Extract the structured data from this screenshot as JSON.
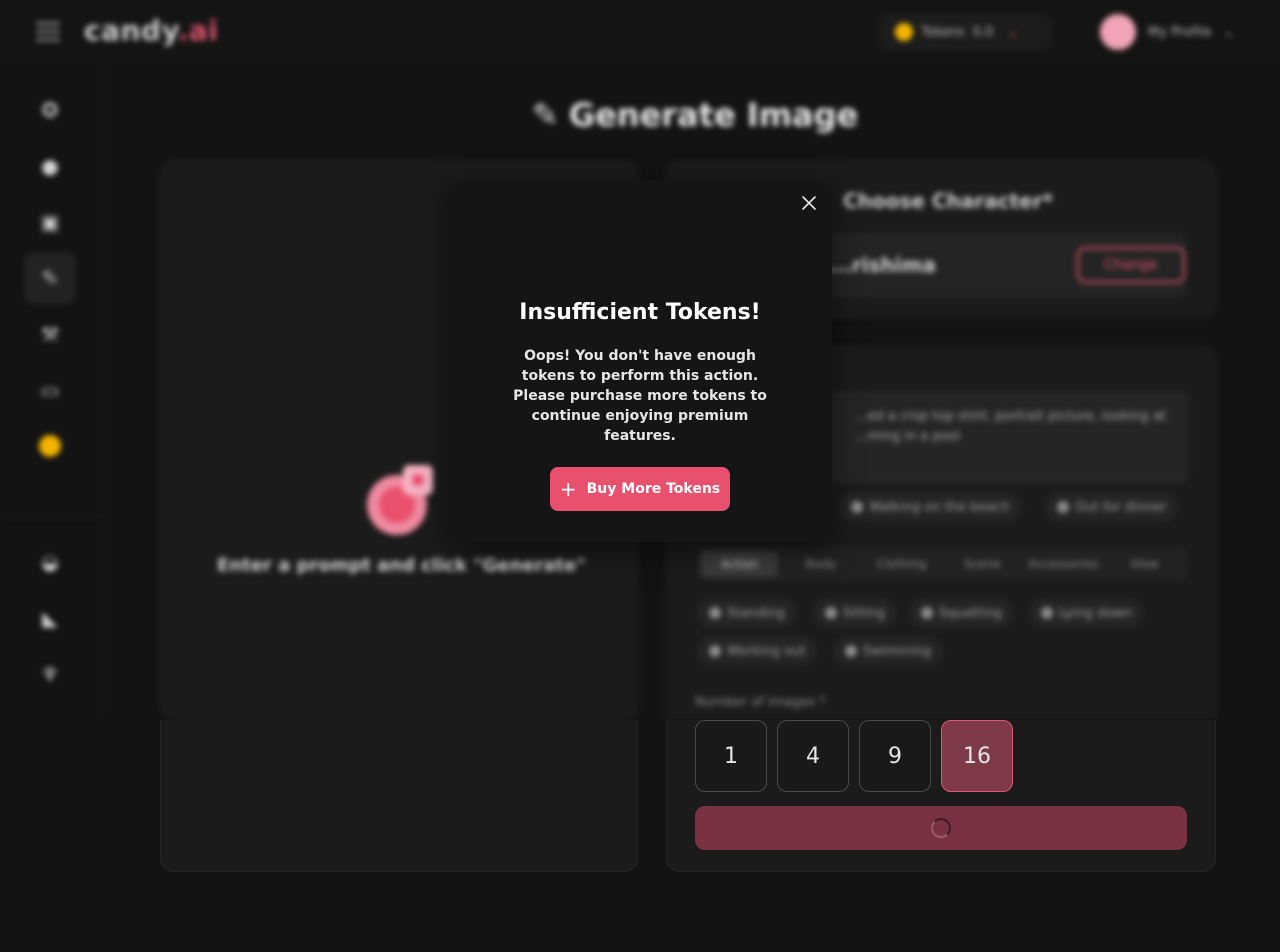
{
  "header": {
    "logo_main": "candy",
    "logo_suffix": ".ai",
    "tokens_label": "Tokens",
    "tokens_value": "0.0",
    "profile_label": "My Profile"
  },
  "sidebar": {
    "items": [
      {
        "icon": "compass-icon"
      },
      {
        "icon": "chat-icon"
      },
      {
        "icon": "gallery-icon"
      },
      {
        "icon": "brush-icon",
        "active": true
      },
      {
        "icon": "magic-wand-icon"
      },
      {
        "icon": "ticket-icon"
      },
      {
        "icon": "coin-premium-icon"
      },
      {
        "icon": "discord-icon"
      },
      {
        "icon": "megaphone-icon"
      },
      {
        "icon": "trophy-icon"
      }
    ]
  },
  "page": {
    "title": "Generate Image",
    "placeholder_text": "Enter a prompt and click \"Generate\""
  },
  "character": {
    "label": "Choose Character*",
    "name": "...rishima",
    "change_label": "Change"
  },
  "prompt": {
    "text_line1": "...ed a crop top shirt, portrait picture, looking at",
    "text_line2": "...ming in a pool",
    "suggestions": [
      "Walking on the beach",
      "Out for dinner"
    ],
    "tabs": [
      "Action",
      "Body",
      "Clothing",
      "Scene",
      "Accessories",
      "View"
    ],
    "poses": [
      "Standing",
      "Sitting",
      "Squatting",
      "Lying down",
      "Working out",
      "Swimming"
    ]
  },
  "images": {
    "label": "Number of images *",
    "options": [
      "1",
      "4",
      "9",
      "16"
    ],
    "selected": "16"
  },
  "modal": {
    "title": "Insufficient Tokens!",
    "message": "Oops! You don't have enough tokens to perform this action. Please purchase more tokens to continue enjoying premium features.",
    "button_label": "Buy More Tokens"
  },
  "colors": {
    "accent": "#e8506e",
    "selected_bg": "#7f3a49",
    "generate_bg": "#7a3142"
  }
}
